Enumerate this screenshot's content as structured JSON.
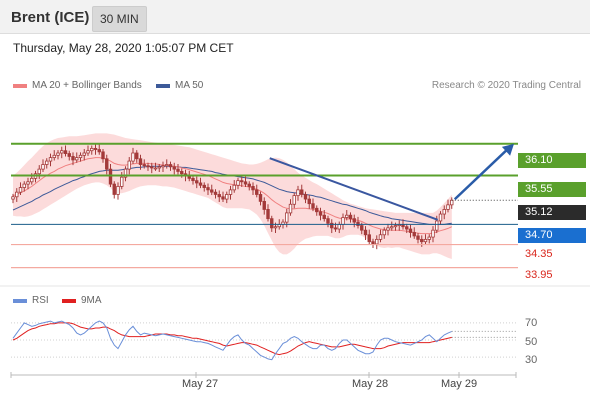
{
  "header": {
    "instrument": "Brent (ICE)",
    "timeframe": "30 MIN",
    "datetime": "Thursday, May 28, 2020 1:05:07 PM CET"
  },
  "legend": {
    "ma20": "MA 20 + Bollinger Bands",
    "ma50": "MA 50",
    "credit": "Research © 2020 Trading Central",
    "rsi": "RSI",
    "ma9": "9MA"
  },
  "colors": {
    "ma20": "#f08080",
    "ma50": "#3d5a99",
    "bollinger_fill": "#fbd5d5",
    "candle": "#a33a3a",
    "resistance": "#5aa02c",
    "support": "#1a5d8a",
    "pivot": "#f4a9a0",
    "current": "#2b2b2b",
    "trend_line": "#3a57a0",
    "arrow": "#2a5ca8",
    "rsi": "#6a8fd8",
    "rsi_ma": "#e02020"
  },
  "chart_data": {
    "type": "candlestick",
    "title": "Brent (ICE)",
    "timeframe": "30 MIN",
    "ylim": [
      33.7,
      36.6
    ],
    "price_tags": [
      {
        "label": "36.10",
        "kind": "resistance"
      },
      {
        "label": "35.55",
        "kind": "resistance"
      },
      {
        "label": "35.12",
        "kind": "current"
      },
      {
        "label": "34.70",
        "kind": "support"
      },
      {
        "label": "34.35",
        "kind": "pivot"
      },
      {
        "label": "33.95",
        "kind": "pivot"
      }
    ],
    "levels": [
      36.1,
      35.55,
      35.12,
      34.7,
      34.35,
      33.95
    ],
    "x_labels": [
      "May 27",
      "May 28",
      "May 29"
    ],
    "close": [
      35.18,
      35.26,
      35.34,
      35.4,
      35.44,
      35.5,
      35.58,
      35.66,
      35.74,
      35.8,
      35.86,
      35.9,
      35.94,
      35.98,
      35.93,
      35.88,
      35.82,
      35.86,
      35.9,
      35.94,
      35.98,
      36.02,
      36.0,
      35.96,
      35.84,
      35.66,
      35.4,
      35.22,
      35.36,
      35.52,
      35.66,
      35.8,
      35.94,
      35.84,
      35.74,
      35.72,
      35.7,
      35.68,
      35.68,
      35.7,
      35.72,
      35.74,
      35.7,
      35.66,
      35.62,
      35.58,
      35.54,
      35.5,
      35.46,
      35.42,
      35.38,
      35.34,
      35.3,
      35.26,
      35.22,
      35.18,
      35.14,
      35.22,
      35.3,
      35.38,
      35.46,
      35.44,
      35.4,
      35.36,
      35.3,
      35.22,
      35.1,
      34.96,
      34.8,
      34.64,
      34.66,
      34.7,
      34.74,
      34.9,
      35.05,
      35.2,
      35.3,
      35.22,
      35.14,
      35.06,
      34.98,
      34.92,
      34.86,
      34.8,
      34.72,
      34.64,
      34.62,
      34.7,
      34.82,
      34.86,
      34.8,
      34.74,
      34.68,
      34.6,
      34.52,
      34.4,
      34.36,
      34.44,
      34.52,
      34.6,
      34.64,
      34.66,
      34.68,
      34.7,
      34.66,
      34.62,
      34.56,
      34.5,
      34.44,
      34.4,
      34.44,
      34.48,
      34.6,
      34.76,
      34.88,
      34.96,
      35.04,
      35.12
    ],
    "ma20": [
      35.2,
      35.22,
      35.25,
      35.28,
      35.32,
      35.36,
      35.41,
      35.46,
      35.51,
      35.55,
      35.59,
      35.62,
      35.66,
      35.69,
      35.72,
      35.74,
      35.76,
      35.78,
      35.8,
      35.82,
      35.84,
      35.85,
      35.86,
      35.86,
      35.85,
      35.83,
      35.8,
      35.76,
      35.74,
      35.73,
      35.73,
      35.74,
      35.75,
      35.76,
      35.76,
      35.76,
      35.76,
      35.75,
      35.75,
      35.74,
      35.73,
      35.73,
      35.72,
      35.71,
      35.7,
      35.68,
      35.67,
      35.65,
      35.63,
      35.61,
      35.59,
      35.57,
      35.55,
      35.52,
      35.49,
      35.46,
      35.43,
      35.41,
      35.4,
      35.39,
      35.38,
      35.37,
      35.36,
      35.35,
      35.33,
      35.31,
      35.28,
      35.24,
      35.19,
      35.13,
      35.08,
      35.04,
      35.0,
      34.98,
      34.97,
      34.97,
      34.98,
      34.98,
      34.98,
      34.97,
      34.96,
      34.95,
      34.93,
      34.91,
      34.89,
      34.86,
      34.83,
      34.81,
      34.8,
      34.8,
      34.79,
      34.78,
      34.77,
      34.75,
      34.72,
      34.69,
      34.66,
      34.64,
      34.62,
      34.61,
      34.61,
      34.6,
      34.6,
      34.6,
      34.59,
      34.58,
      34.57,
      34.56,
      34.55,
      34.54,
      34.54,
      34.54,
      34.55,
      34.57,
      34.59,
      34.61,
      34.63,
      34.66
    ],
    "ma50": [
      34.95,
      34.98,
      35.01,
      35.04,
      35.07,
      35.1,
      35.14,
      35.17,
      35.21,
      35.24,
      35.27,
      35.31,
      35.34,
      35.37,
      35.4,
      35.43,
      35.46,
      35.48,
      35.51,
      35.53,
      35.56,
      35.58,
      35.6,
      35.62,
      35.63,
      35.64,
      35.64,
      35.64,
      35.64,
      35.65,
      35.66,
      35.67,
      35.68,
      35.69,
      35.69,
      35.7,
      35.7,
      35.71,
      35.71,
      35.71,
      35.71,
      35.71,
      35.71,
      35.7,
      35.7,
      35.69,
      35.69,
      35.68,
      35.67,
      35.66,
      35.65,
      35.64,
      35.63,
      35.62,
      35.6,
      35.59,
      35.57,
      35.56,
      35.55,
      35.54,
      35.53,
      35.52,
      35.51,
      35.5,
      35.49,
      35.47,
      35.45,
      35.43,
      35.4,
      35.37,
      35.34,
      35.31,
      35.29,
      35.27,
      35.26,
      35.25,
      35.24,
      35.23,
      35.22,
      35.21,
      35.2,
      35.18,
      35.17,
      35.15,
      35.13,
      35.11,
      35.09,
      35.07,
      35.05,
      35.04,
      35.02,
      35.0,
      34.98,
      34.96,
      34.94,
      34.91,
      34.89,
      34.87,
      34.85,
      34.83,
      34.82,
      34.8,
      34.79,
      34.78,
      34.77,
      34.76,
      34.75,
      34.74,
      34.73,
      34.72,
      34.71,
      34.7,
      34.7,
      34.7,
      34.7,
      34.7,
      34.71,
      34.72
    ],
    "bollinger_upper": [
      35.55,
      35.6,
      35.66,
      35.73,
      35.8,
      35.86,
      35.93,
      36.0,
      36.06,
      36.11,
      36.15,
      36.18,
      36.2,
      36.21,
      36.22,
      36.23,
      36.23,
      36.23,
      36.24,
      36.25,
      36.26,
      36.27,
      36.28,
      36.28,
      36.28,
      36.28,
      36.27,
      36.26,
      36.24,
      36.22,
      36.2,
      36.19,
      36.18,
      36.17,
      36.16,
      36.15,
      36.14,
      36.13,
      36.12,
      36.11,
      36.1,
      36.1,
      36.09,
      36.08,
      36.07,
      36.06,
      36.05,
      36.04,
      36.02,
      36.0,
      35.98,
      35.96,
      35.94,
      35.92,
      35.9,
      35.88,
      35.86,
      35.84,
      35.82,
      35.8,
      35.78,
      35.76,
      35.75,
      35.74,
      35.74,
      35.75,
      35.77,
      35.8,
      35.83,
      35.85,
      35.86,
      35.85,
      35.82,
      35.78,
      35.72,
      35.66,
      35.6,
      35.55,
      35.51,
      35.47,
      35.43,
      35.4,
      35.36,
      35.32,
      35.28,
      35.24,
      35.2,
      35.16,
      35.12,
      35.09,
      35.06,
      35.04,
      35.02,
      35.0,
      34.98,
      34.97,
      34.96,
      34.95,
      34.94,
      34.93,
      34.92,
      34.91,
      34.9,
      34.9,
      34.9,
      34.9,
      34.9,
      34.9,
      34.9,
      34.9,
      34.9,
      34.9,
      34.9,
      34.94,
      35.0,
      35.07,
      35.14,
      35.22
    ],
    "bollinger_lower": [
      34.85,
      34.84,
      34.84,
      34.83,
      34.84,
      34.86,
      34.89,
      34.92,
      34.96,
      35.0,
      35.04,
      35.08,
      35.12,
      35.16,
      35.2,
      35.24,
      35.28,
      35.32,
      35.35,
      35.38,
      35.4,
      35.42,
      35.43,
      35.43,
      35.41,
      35.38,
      35.33,
      35.26,
      35.24,
      35.24,
      35.26,
      35.28,
      35.31,
      35.34,
      35.36,
      35.37,
      35.38,
      35.38,
      35.38,
      35.37,
      35.36,
      35.36,
      35.35,
      35.34,
      35.32,
      35.3,
      35.28,
      35.26,
      35.24,
      35.22,
      35.2,
      35.18,
      35.16,
      35.12,
      35.08,
      35.04,
      35.0,
      34.98,
      34.98,
      34.98,
      34.98,
      34.98,
      34.97,
      34.96,
      34.92,
      34.87,
      34.79,
      34.68,
      34.55,
      34.42,
      34.3,
      34.22,
      34.18,
      34.18,
      34.22,
      34.28,
      34.36,
      34.41,
      34.45,
      34.47,
      34.49,
      34.5,
      34.5,
      34.5,
      34.5,
      34.48,
      34.46,
      34.46,
      34.48,
      34.51,
      34.52,
      34.52,
      34.52,
      34.5,
      34.46,
      34.41,
      34.36,
      34.33,
      34.3,
      34.29,
      34.3,
      34.29,
      34.3,
      34.3,
      34.28,
      34.26,
      34.24,
      34.22,
      34.2,
      34.18,
      34.18,
      34.18,
      34.2,
      34.2,
      34.18,
      34.15,
      34.12,
      34.1
    ],
    "rsi": {
      "levels": [
        70,
        50,
        30
      ],
      "ylim": [
        15,
        85
      ],
      "rsi": [
        52,
        58,
        64,
        70,
        68,
        66,
        67,
        69,
        70,
        71,
        72,
        70,
        71,
        72,
        70,
        68,
        64,
        58,
        56,
        58,
        62,
        66,
        70,
        72,
        70,
        64,
        52,
        44,
        40,
        48,
        56,
        62,
        66,
        60,
        56,
        58,
        57,
        56,
        55,
        56,
        57,
        56,
        55,
        54,
        53,
        52,
        51,
        50,
        49,
        48,
        48,
        47,
        46,
        44,
        42,
        40,
        38,
        44,
        50,
        54,
        56,
        50,
        46,
        44,
        40,
        36,
        32,
        30,
        28,
        27,
        34,
        40,
        46,
        48,
        52,
        54,
        52,
        48,
        45,
        42,
        40,
        40,
        44,
        44,
        40,
        38,
        40,
        46,
        50,
        50,
        46,
        42,
        38,
        36,
        34,
        34,
        36,
        44,
        50,
        52,
        52,
        50,
        48,
        47,
        46,
        45,
        44,
        46,
        48,
        50,
        54,
        56,
        52,
        48,
        52,
        56,
        58,
        60
      ],
      "ma9": [
        50,
        52,
        55,
        58,
        61,
        63,
        64,
        66,
        67,
        68,
        69,
        69,
        70,
        70,
        70,
        70,
        69,
        67,
        65,
        64,
        63,
        63,
        64,
        64,
        65,
        65,
        63,
        61,
        58,
        56,
        55,
        54,
        54,
        54,
        54,
        54,
        55,
        56,
        57,
        57,
        57,
        57,
        56,
        56,
        55,
        55,
        54,
        53,
        52,
        52,
        51,
        50,
        49,
        48,
        47,
        46,
        44,
        43,
        44,
        45,
        46,
        47,
        47,
        46,
        45,
        44,
        42,
        40,
        38,
        36,
        34,
        33,
        34,
        35,
        37,
        40,
        43,
        45,
        47,
        48,
        47,
        46,
        45,
        44,
        43,
        42,
        42,
        42,
        43,
        44,
        45,
        45,
        44,
        43,
        42,
        41,
        40,
        40,
        40,
        41,
        43,
        44,
        45,
        46,
        47,
        47,
        47,
        47,
        47,
        47,
        47,
        47,
        48,
        49,
        50,
        51,
        52,
        53
      ]
    }
  }
}
